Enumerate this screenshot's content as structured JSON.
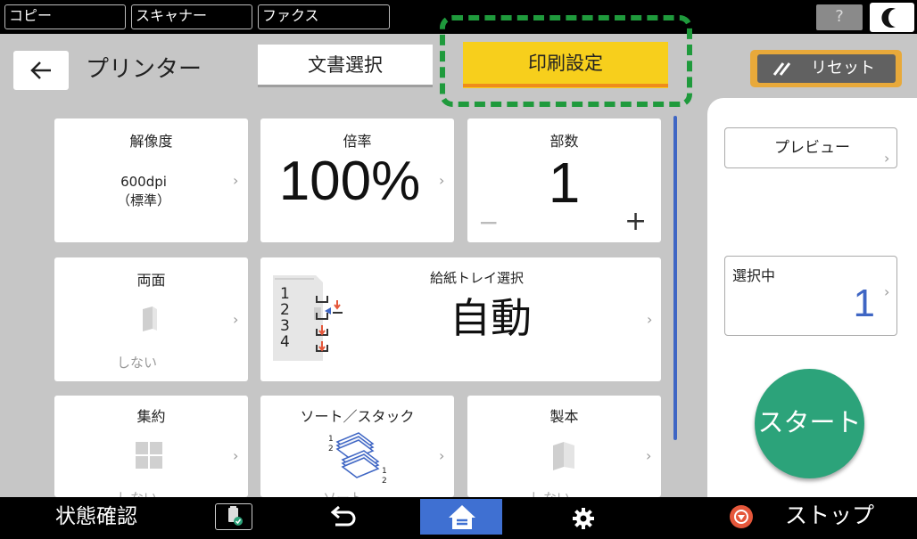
{
  "top_tabs": [
    "コピー",
    "スキャナー",
    "ファクス"
  ],
  "help_label": "?",
  "header": {
    "title": "プリンター",
    "tab_document": "文書選択",
    "tab_print_settings": "印刷設定",
    "reset_label": "リセット"
  },
  "tiles": {
    "resolution": {
      "title": "解像度",
      "value_line1": "600dpi",
      "value_line2": "（標準）"
    },
    "scale": {
      "title": "倍率",
      "value": "100%"
    },
    "copies": {
      "title": "部数",
      "value": "1",
      "minus": "−",
      "plus": "+"
    },
    "duplex": {
      "title": "両面",
      "value": "しない"
    },
    "tray": {
      "title": "給紙トレイ選択",
      "value": "自動",
      "trays": [
        "1",
        "2",
        "3",
        "4"
      ]
    },
    "nup": {
      "title": "集約",
      "value": "しない"
    },
    "sort": {
      "title": "ソート／スタック",
      "value": "ソート"
    },
    "bookbinding": {
      "title": "製本",
      "value": "しない"
    }
  },
  "right_panel": {
    "preview_label": "プレビュー",
    "selected_label": "選択中",
    "selected_count": "1",
    "start_label": "スタート"
  },
  "bottom_bar": {
    "status_label": "状態確認",
    "stop_label": "ストップ"
  },
  "colors": {
    "accent_yellow": "#f7cf1c",
    "accent_orange": "#ef8c1b",
    "highlight_green": "#1f9a3c",
    "start_green": "#2ca37a",
    "home_blue": "#3f70d2",
    "stop_red": "#e5573b"
  },
  "icons": [
    "back-arrow-icon",
    "reset-icon",
    "duplex-icon",
    "tray-icon",
    "nup-icon",
    "sort-stack-icon",
    "bookbinding-icon",
    "job-list-icon",
    "return-icon",
    "home-icon",
    "settings-icon",
    "stop-icon",
    "night-mode-icon",
    "help-icon"
  ]
}
